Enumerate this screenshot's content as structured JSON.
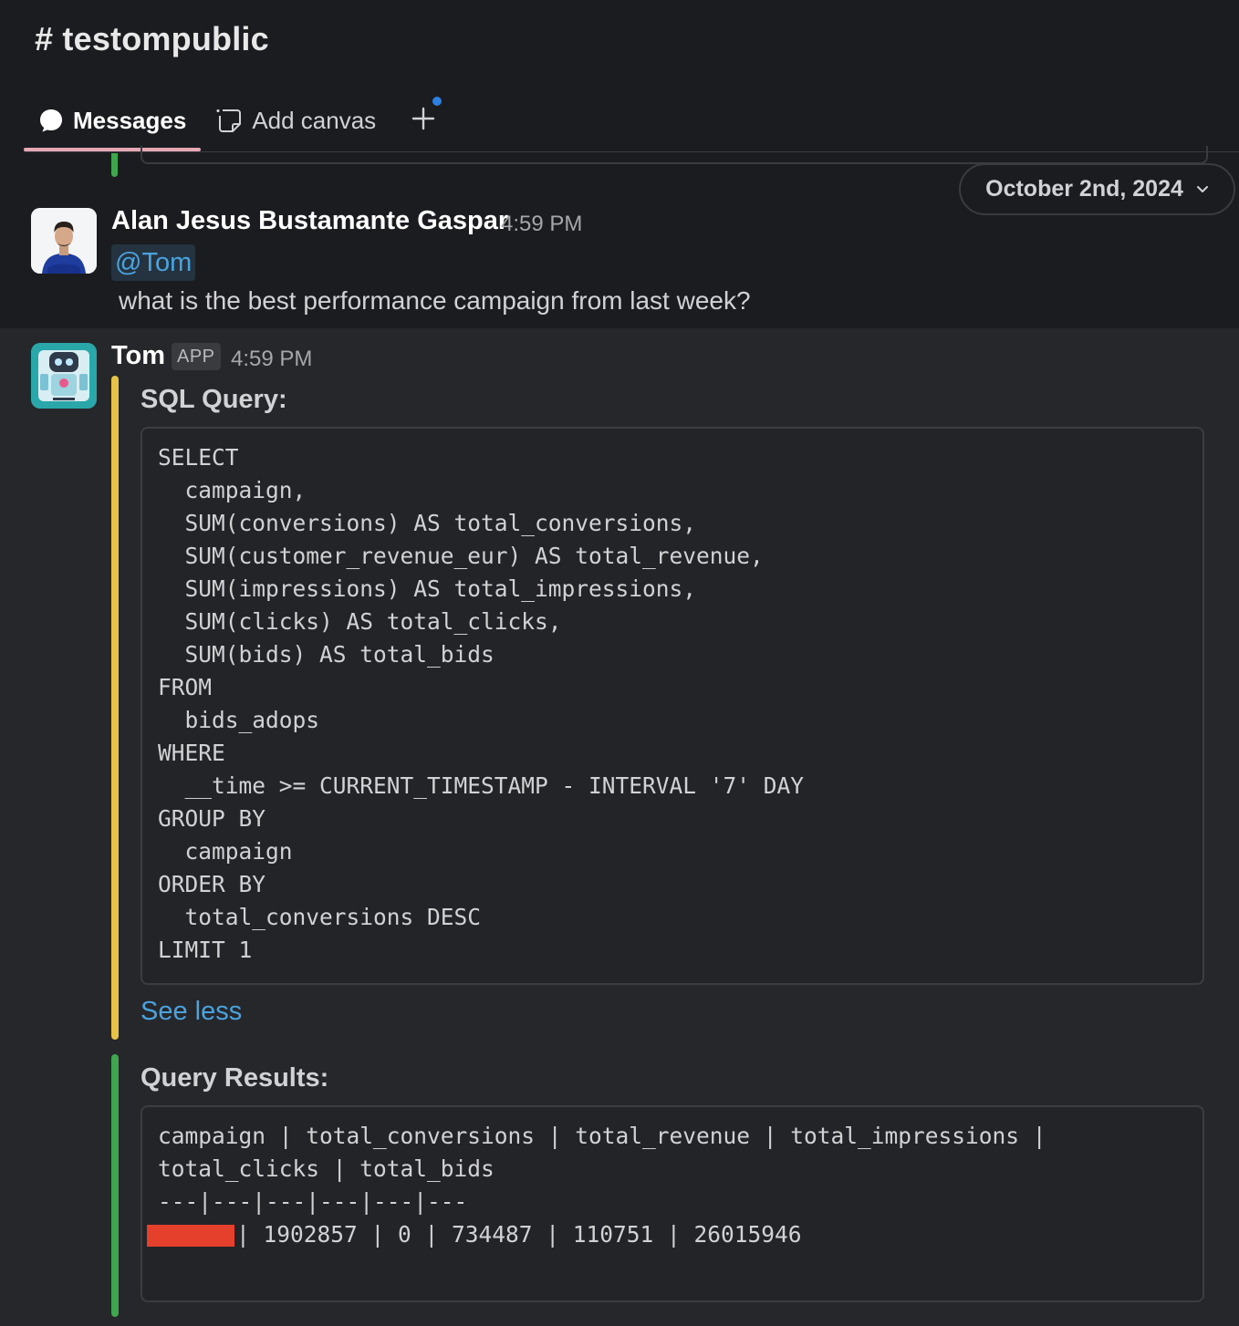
{
  "channel": {
    "title": "# testompublic"
  },
  "tabs": [
    {
      "label": "Messages",
      "icon": "chat-bubble-icon",
      "active": true
    },
    {
      "label": "Add canvas",
      "icon": "add-canvas-icon",
      "active": false
    }
  ],
  "add_tab": {
    "icon": "plus-icon"
  },
  "date_divider": {
    "label": "October 2nd, 2024",
    "icon": "chevron-down-icon"
  },
  "messages": [
    {
      "author": "Alan Jesus Bustamante Gaspar",
      "time": "4:59 PM",
      "mention": "@Tom",
      "text": "what is the best performance campaign from last week?"
    },
    {
      "author": "Tom",
      "badge": "APP",
      "time": "4:59 PM",
      "sql_block": {
        "title": "SQL Query:",
        "accent_color": "#e6c24a",
        "lines": [
          "SELECT",
          "  campaign,",
          "  SUM(conversions) AS total_conversions,",
          "  SUM(customer_revenue_eur) AS total_revenue,",
          "  SUM(impressions) AS total_impressions,",
          "  SUM(clicks) AS total_clicks,",
          "  SUM(bids) AS total_bids",
          "FROM",
          "  bids_adops",
          "WHERE",
          "  __time >= CURRENT_TIMESTAMP - INTERVAL '7' DAY",
          "GROUP BY",
          "  campaign",
          "ORDER BY",
          "  total_conversions DESC",
          "LIMIT 1"
        ],
        "toggle_label": "See less"
      },
      "results_block": {
        "title": "Query Results:",
        "accent_color": "#3fa64f",
        "lines": [
          "campaign | total_conversions | total_revenue | total_impressions |",
          "total_clicks | total_bids",
          "---|---|---|---|---|---"
        ],
        "row_after_redaction": "| 1902857 | 0 | 734487 | 110751 | 26015946",
        "redaction_color": "#e5402b"
      }
    }
  ]
}
